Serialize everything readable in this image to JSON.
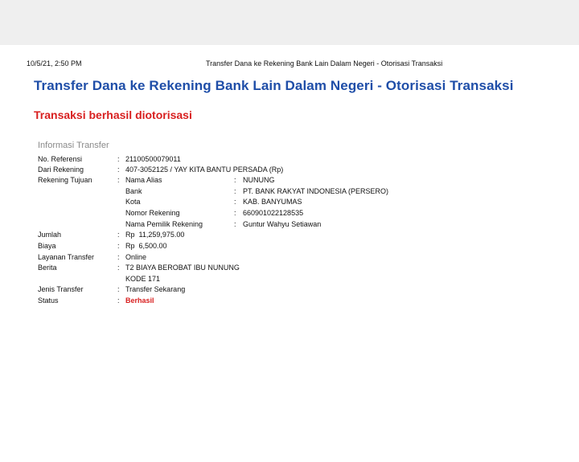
{
  "print_header": {
    "datetime": "10/5/21, 2:50 PM",
    "page_title": "Transfer Dana ke Rekening Bank Lain Dalam Negeri - Otorisasi Transaksi"
  },
  "title": "Transfer Dana ke Rekening Bank Lain Dalam Negeri - Otorisasi Transaksi",
  "success_message": "Transaksi berhasil diotorisasi",
  "section_title": "Informasi Transfer",
  "separator": ":",
  "fields": {
    "no_referensi": {
      "label": "No. Referensi",
      "value": "21100500079011"
    },
    "dari_rekening": {
      "label": "Dari Rekening",
      "value": "407-3052125 / YAY KITA BANTU PERSADA (Rp)"
    },
    "rekening_tujuan": {
      "label": "Rekening Tujuan",
      "sub": {
        "nama_alias": {
          "label": "Nama Alias",
          "value": "NUNUNG"
        },
        "bank": {
          "label": "Bank",
          "value": "PT. BANK RAKYAT INDONESIA (PERSERO)"
        },
        "kota": {
          "label": "Kota",
          "value": "KAB. BANYUMAS"
        },
        "nomor_rekening": {
          "label": "Nomor Rekening",
          "value": "660901022128535"
        },
        "nama_pemilik": {
          "label": "Nama Pemilik Rekening",
          "value": "Guntur Wahyu Setiawan"
        }
      }
    },
    "jumlah": {
      "label": "Jumlah",
      "value": "Rp  11,259,975.00"
    },
    "biaya": {
      "label": "Biaya",
      "value": "Rp  6,500.00"
    },
    "layanan_transfer": {
      "label": "Layanan Transfer",
      "value": "Online"
    },
    "berita": {
      "label": "Berita",
      "value_line1": "T2 BIAYA BEROBAT IBU NUNUNG",
      "value_line2": "KODE 171"
    },
    "jenis_transfer": {
      "label": "Jenis Transfer",
      "value": "Transfer Sekarang"
    },
    "status": {
      "label": "Status",
      "value": "Berhasil"
    }
  }
}
